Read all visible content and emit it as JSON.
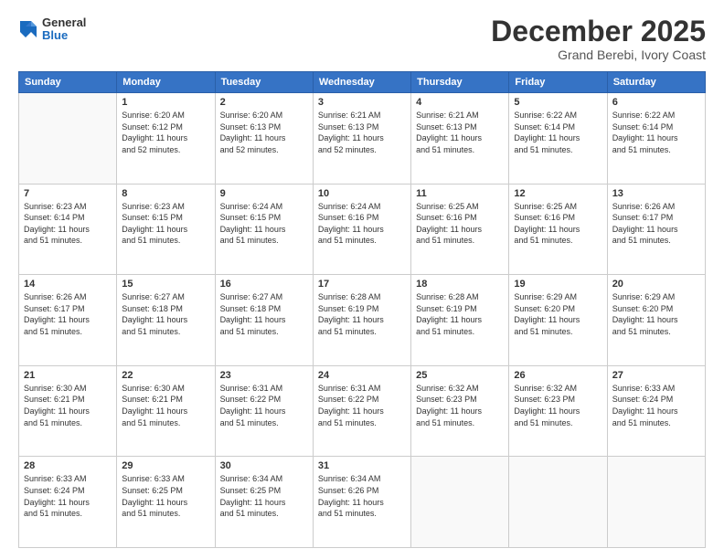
{
  "header": {
    "logo_general": "General",
    "logo_blue": "Blue",
    "month_title": "December 2025",
    "location": "Grand Berebi, Ivory Coast"
  },
  "days_of_week": [
    "Sunday",
    "Monday",
    "Tuesday",
    "Wednesday",
    "Thursday",
    "Friday",
    "Saturday"
  ],
  "weeks": [
    [
      {
        "day": "",
        "info": ""
      },
      {
        "day": "1",
        "info": "Sunrise: 6:20 AM\nSunset: 6:12 PM\nDaylight: 11 hours\nand 52 minutes."
      },
      {
        "day": "2",
        "info": "Sunrise: 6:20 AM\nSunset: 6:13 PM\nDaylight: 11 hours\nand 52 minutes."
      },
      {
        "day": "3",
        "info": "Sunrise: 6:21 AM\nSunset: 6:13 PM\nDaylight: 11 hours\nand 52 minutes."
      },
      {
        "day": "4",
        "info": "Sunrise: 6:21 AM\nSunset: 6:13 PM\nDaylight: 11 hours\nand 51 minutes."
      },
      {
        "day": "5",
        "info": "Sunrise: 6:22 AM\nSunset: 6:14 PM\nDaylight: 11 hours\nand 51 minutes."
      },
      {
        "day": "6",
        "info": "Sunrise: 6:22 AM\nSunset: 6:14 PM\nDaylight: 11 hours\nand 51 minutes."
      }
    ],
    [
      {
        "day": "7",
        "info": "Sunrise: 6:23 AM\nSunset: 6:14 PM\nDaylight: 11 hours\nand 51 minutes."
      },
      {
        "day": "8",
        "info": "Sunrise: 6:23 AM\nSunset: 6:15 PM\nDaylight: 11 hours\nand 51 minutes."
      },
      {
        "day": "9",
        "info": "Sunrise: 6:24 AM\nSunset: 6:15 PM\nDaylight: 11 hours\nand 51 minutes."
      },
      {
        "day": "10",
        "info": "Sunrise: 6:24 AM\nSunset: 6:16 PM\nDaylight: 11 hours\nand 51 minutes."
      },
      {
        "day": "11",
        "info": "Sunrise: 6:25 AM\nSunset: 6:16 PM\nDaylight: 11 hours\nand 51 minutes."
      },
      {
        "day": "12",
        "info": "Sunrise: 6:25 AM\nSunset: 6:16 PM\nDaylight: 11 hours\nand 51 minutes."
      },
      {
        "day": "13",
        "info": "Sunrise: 6:26 AM\nSunset: 6:17 PM\nDaylight: 11 hours\nand 51 minutes."
      }
    ],
    [
      {
        "day": "14",
        "info": "Sunrise: 6:26 AM\nSunset: 6:17 PM\nDaylight: 11 hours\nand 51 minutes."
      },
      {
        "day": "15",
        "info": "Sunrise: 6:27 AM\nSunset: 6:18 PM\nDaylight: 11 hours\nand 51 minutes."
      },
      {
        "day": "16",
        "info": "Sunrise: 6:27 AM\nSunset: 6:18 PM\nDaylight: 11 hours\nand 51 minutes."
      },
      {
        "day": "17",
        "info": "Sunrise: 6:28 AM\nSunset: 6:19 PM\nDaylight: 11 hours\nand 51 minutes."
      },
      {
        "day": "18",
        "info": "Sunrise: 6:28 AM\nSunset: 6:19 PM\nDaylight: 11 hours\nand 51 minutes."
      },
      {
        "day": "19",
        "info": "Sunrise: 6:29 AM\nSunset: 6:20 PM\nDaylight: 11 hours\nand 51 minutes."
      },
      {
        "day": "20",
        "info": "Sunrise: 6:29 AM\nSunset: 6:20 PM\nDaylight: 11 hours\nand 51 minutes."
      }
    ],
    [
      {
        "day": "21",
        "info": "Sunrise: 6:30 AM\nSunset: 6:21 PM\nDaylight: 11 hours\nand 51 minutes."
      },
      {
        "day": "22",
        "info": "Sunrise: 6:30 AM\nSunset: 6:21 PM\nDaylight: 11 hours\nand 51 minutes."
      },
      {
        "day": "23",
        "info": "Sunrise: 6:31 AM\nSunset: 6:22 PM\nDaylight: 11 hours\nand 51 minutes."
      },
      {
        "day": "24",
        "info": "Sunrise: 6:31 AM\nSunset: 6:22 PM\nDaylight: 11 hours\nand 51 minutes."
      },
      {
        "day": "25",
        "info": "Sunrise: 6:32 AM\nSunset: 6:23 PM\nDaylight: 11 hours\nand 51 minutes."
      },
      {
        "day": "26",
        "info": "Sunrise: 6:32 AM\nSunset: 6:23 PM\nDaylight: 11 hours\nand 51 minutes."
      },
      {
        "day": "27",
        "info": "Sunrise: 6:33 AM\nSunset: 6:24 PM\nDaylight: 11 hours\nand 51 minutes."
      }
    ],
    [
      {
        "day": "28",
        "info": "Sunrise: 6:33 AM\nSunset: 6:24 PM\nDaylight: 11 hours\nand 51 minutes."
      },
      {
        "day": "29",
        "info": "Sunrise: 6:33 AM\nSunset: 6:25 PM\nDaylight: 11 hours\nand 51 minutes."
      },
      {
        "day": "30",
        "info": "Sunrise: 6:34 AM\nSunset: 6:25 PM\nDaylight: 11 hours\nand 51 minutes."
      },
      {
        "day": "31",
        "info": "Sunrise: 6:34 AM\nSunset: 6:26 PM\nDaylight: 11 hours\nand 51 minutes."
      },
      {
        "day": "",
        "info": ""
      },
      {
        "day": "",
        "info": ""
      },
      {
        "day": "",
        "info": ""
      }
    ]
  ]
}
